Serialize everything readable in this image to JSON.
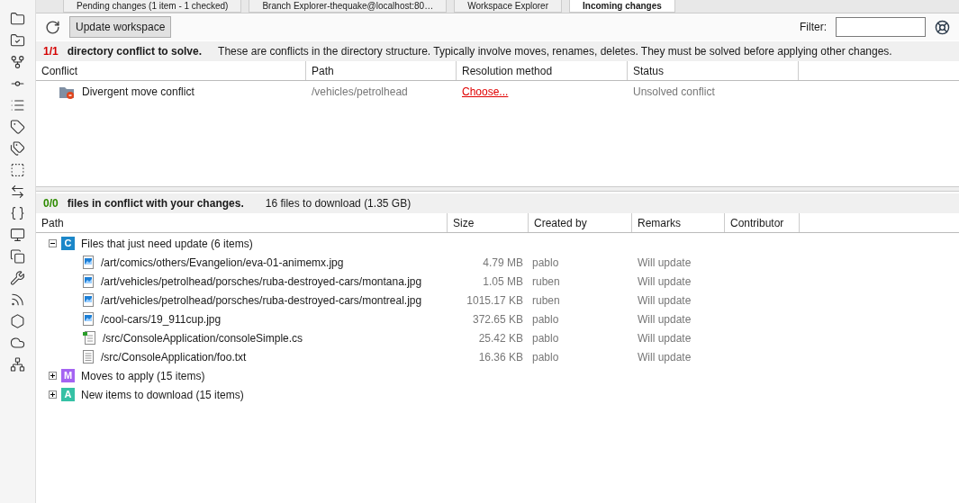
{
  "tabs": [
    {
      "label": "Pending changes (1 item - 1 checked)",
      "selected": false
    },
    {
      "label": "Branch Explorer-thequake@localhost:80…",
      "selected": false
    },
    {
      "label": "Workspace Explorer",
      "selected": false
    },
    {
      "label": "Incoming changes",
      "selected": true
    }
  ],
  "sidebar": {
    "items": [
      {
        "kind": "folder"
      },
      {
        "kind": "folder-check"
      },
      {
        "kind": "branch"
      },
      {
        "kind": "commit"
      },
      {
        "kind": "list"
      },
      {
        "kind": "tag"
      },
      {
        "kind": "tags"
      },
      {
        "kind": "dashed"
      },
      {
        "kind": "swap"
      },
      {
        "kind": "code"
      },
      {
        "kind": "monitor"
      },
      {
        "kind": "copy"
      },
      {
        "kind": "wrench"
      },
      {
        "kind": "rss"
      },
      {
        "kind": "hexagon"
      },
      {
        "kind": "cloud"
      },
      {
        "kind": "network"
      }
    ]
  },
  "toolbar": {
    "button": "Update workspace",
    "filter_label": "Filter:"
  },
  "directory_conflicts": {
    "count": "1/1",
    "title": "directory conflict to solve.",
    "description": "These are conflicts in the directory structure. Typically involve moves, renames, deletes. They must be solved before applying other changes.",
    "columns": [
      "Conflict",
      "Path",
      "Resolution method",
      "Status"
    ],
    "rows": [
      {
        "conflict": "Divergent move conflict",
        "path": "/vehicles/petrolhead",
        "resolution": "Choose...",
        "status": "Unsolved conflict"
      }
    ]
  },
  "file_conflicts": {
    "count": "0/0",
    "title": "files in conflict with your changes.",
    "summary": "16 files to download (1.35 GB)",
    "columns": [
      "Path",
      "Size",
      "Created by",
      "Remarks",
      "Contributor"
    ],
    "groups": [
      {
        "badge": "C",
        "color": "#1b87c9",
        "label": "Files that just need update (6 items)",
        "expanded": true,
        "children": [
          {
            "kind": "image",
            "path": "/art/comics/others/Evangelion/eva-01-animemx.jpg",
            "size": "4.79 MB",
            "created_by": "pablo",
            "remarks": "Will update"
          },
          {
            "kind": "image",
            "path": "/art/vehicles/petrolhead/porsches/ruba-destroyed-cars/montana.jpg",
            "size": "1.05 MB",
            "created_by": "ruben",
            "remarks": "Will update"
          },
          {
            "kind": "image",
            "path": "/art/vehicles/petrolhead/porsches/ruba-destroyed-cars/montreal.jpg",
            "size": "1015.17 KB",
            "created_by": "ruben",
            "remarks": "Will update"
          },
          {
            "kind": "image",
            "path": "/cool-cars/19_911cup.jpg",
            "size": "372.65 KB",
            "created_by": "pablo",
            "remarks": "Will update"
          },
          {
            "kind": "csharp",
            "path": "/src/ConsoleApplication/consoleSimple.cs",
            "size": "25.42 KB",
            "created_by": "pablo",
            "remarks": "Will update"
          },
          {
            "kind": "text",
            "path": "/src/ConsoleApplication/foo.txt",
            "size": "16.36 KB",
            "created_by": "pablo",
            "remarks": "Will update"
          }
        ]
      },
      {
        "badge": "M",
        "color": "#a463f2",
        "label": "Moves to apply (15 items)",
        "expanded": false
      },
      {
        "badge": "A",
        "color": "#35c1a5",
        "label": "New items to download (15 items)",
        "expanded": false
      }
    ]
  }
}
